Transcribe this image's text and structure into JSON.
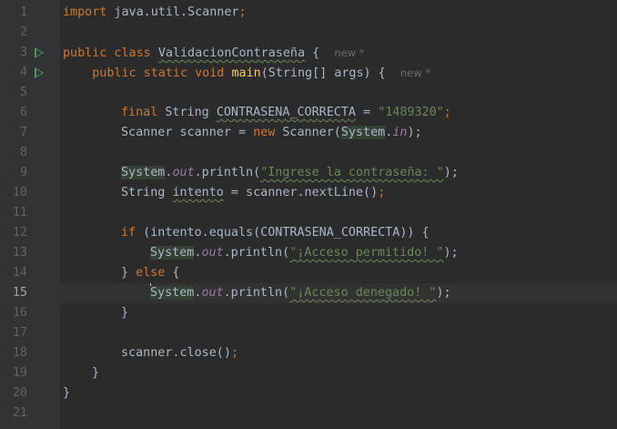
{
  "line_numbers": [
    "1",
    "2",
    "3",
    "4",
    "5",
    "6",
    "7",
    "8",
    "9",
    "10",
    "11",
    "12",
    "13",
    "14",
    "15",
    "16",
    "17",
    "18",
    "19",
    "20",
    "21"
  ],
  "hints": {
    "new_marker": "new *"
  },
  "code": {
    "l1": [
      "import",
      " java.util.Scanner",
      ";"
    ],
    "l3": [
      "public class ",
      "ValidacionContraseña",
      " {  "
    ],
    "l4": [
      "    public static void ",
      "main",
      "(String[] args) {  "
    ],
    "l6": [
      "final",
      " String ",
      "CONTRASENA_CORRECTA",
      " = ",
      "\"1489320\"",
      ";"
    ],
    "l7": [
      "Scanner scanner = ",
      "new",
      " Scanner(",
      "System",
      ".",
      "in",
      ");"
    ],
    "l9": [
      "System",
      ".",
      "out",
      ".println(",
      "\"Ingrese la contraseña: \"",
      ");"
    ],
    "l10": [
      "String ",
      "intento",
      " = scanner.nextLine()",
      ";"
    ],
    "l12": [
      "if",
      " (intento.equals(CONTRASENA_CORRECTA)) {"
    ],
    "l13": [
      "System",
      ".",
      "out",
      ".println(",
      "\"¡Acceso permitido! \"",
      ");"
    ],
    "l14": [
      "} ",
      "else",
      " {"
    ],
    "l15": [
      "System",
      ".",
      "out",
      ".println(",
      "\"¡Acceso denegado! \"",
      ");"
    ],
    "l16": [
      "}"
    ],
    "l18": [
      "scanner.close()",
      ";"
    ],
    "l19": [
      "}"
    ],
    "l20": [
      "}"
    ]
  },
  "colors": {
    "background": "#2b2b2b",
    "gutter": "#313335",
    "keyword": "#cc7832",
    "string": "#6a8759",
    "method_decl": "#ffc66d",
    "static_field": "#9876aa",
    "run_icon": "#499c54"
  },
  "icons": {
    "run_line_3": "run-gutter-icon",
    "run_line_4": "run-gutter-icon"
  }
}
